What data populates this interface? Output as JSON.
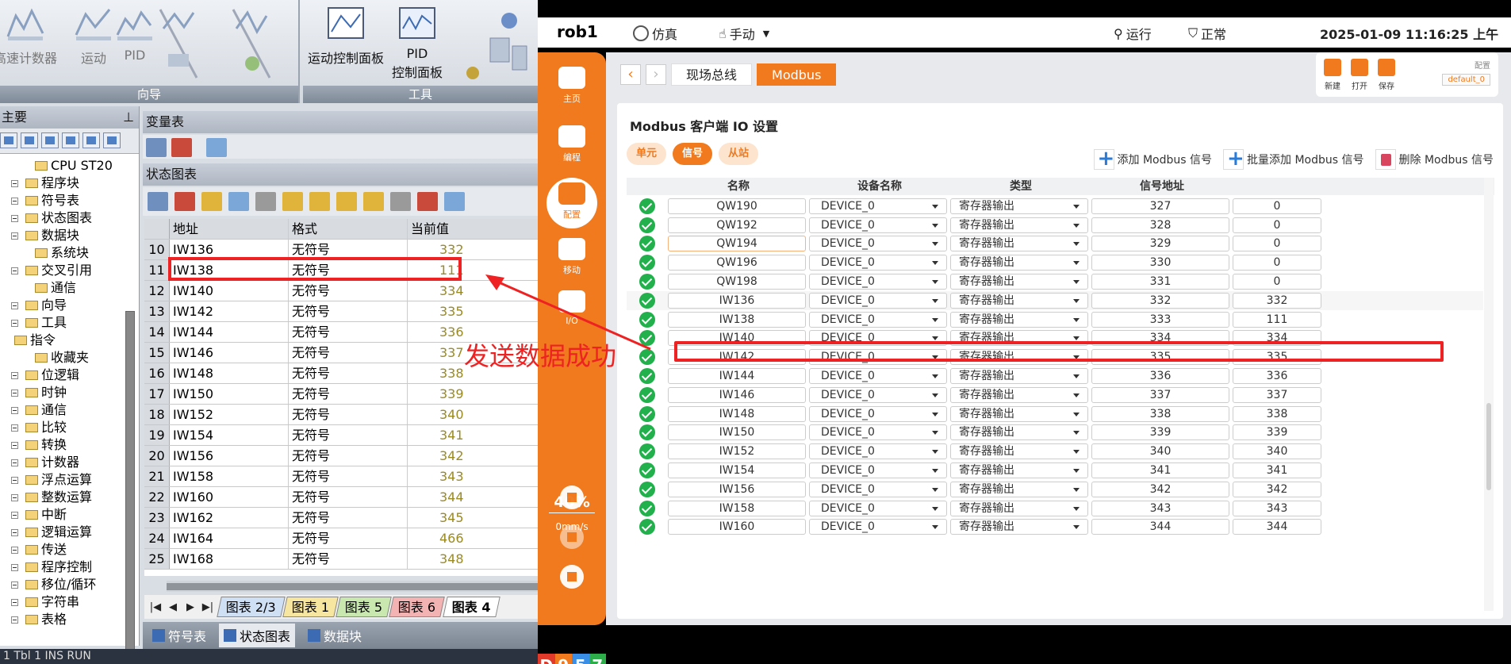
{
  "left": {
    "ribbon": {
      "groups": [
        {
          "title": "向导",
          "items": [
            "高速计数器",
            "运动",
            "PID"
          ]
        },
        {
          "title": "工具",
          "items": [
            "运动控制面板",
            "PID\n控制面板"
          ]
        }
      ]
    },
    "tree": {
      "header": "主要",
      "items": [
        {
          "label": "CPU ST20",
          "level": 2
        },
        {
          "label": "程序块",
          "level": 1
        },
        {
          "label": "符号表",
          "level": 1
        },
        {
          "label": "状态图表",
          "level": 1
        },
        {
          "label": "数据块",
          "level": 1
        },
        {
          "label": "系统块",
          "level": 2
        },
        {
          "label": "交叉引用",
          "level": 1
        },
        {
          "label": "通信",
          "level": 2
        },
        {
          "label": "向导",
          "level": 1
        },
        {
          "label": "工具",
          "level": 1
        },
        {
          "label": "指令",
          "level": 0
        },
        {
          "label": "收藏夹",
          "level": 2
        },
        {
          "label": "位逻辑",
          "level": 1
        },
        {
          "label": "时钟",
          "level": 1
        },
        {
          "label": "通信",
          "level": 1
        },
        {
          "label": "比较",
          "level": 1
        },
        {
          "label": "转换",
          "level": 1
        },
        {
          "label": "计数器",
          "level": 1
        },
        {
          "label": "浮点运算",
          "level": 1
        },
        {
          "label": "整数运算",
          "level": 1
        },
        {
          "label": "中断",
          "level": 1
        },
        {
          "label": "逻辑运算",
          "level": 1
        },
        {
          "label": "传送",
          "level": 1
        },
        {
          "label": "程序控制",
          "level": 1
        },
        {
          "label": "移位/循环",
          "level": 1
        },
        {
          "label": "字符串",
          "level": 1
        },
        {
          "label": "表格",
          "level": 1
        }
      ]
    },
    "var_table_title": "变量表",
    "status_chart_title": "状态图表",
    "grid": {
      "columns": [
        "",
        "地址",
        "格式",
        "当前值"
      ],
      "rows": [
        [
          "10",
          "IW136",
          "无符号",
          "332"
        ],
        [
          "11",
          "IW138",
          "无符号",
          "111"
        ],
        [
          "12",
          "IW140",
          "无符号",
          "334"
        ],
        [
          "13",
          "IW142",
          "无符号",
          "335"
        ],
        [
          "14",
          "IW144",
          "无符号",
          "336"
        ],
        [
          "15",
          "IW146",
          "无符号",
          "337"
        ],
        [
          "16",
          "IW148",
          "无符号",
          "338"
        ],
        [
          "17",
          "IW150",
          "无符号",
          "339"
        ],
        [
          "18",
          "IW152",
          "无符号",
          "340"
        ],
        [
          "19",
          "IW154",
          "无符号",
          "341"
        ],
        [
          "20",
          "IW156",
          "无符号",
          "342"
        ],
        [
          "21",
          "IW158",
          "无符号",
          "343"
        ],
        [
          "22",
          "IW160",
          "无符号",
          "344"
        ],
        [
          "23",
          "IW162",
          "无符号",
          "345"
        ],
        [
          "24",
          "IW164",
          "无符号",
          "466"
        ],
        [
          "25",
          "IW168",
          "无符号",
          "348"
        ]
      ]
    },
    "sheet_tabs": [
      {
        "label": "图表 2/3",
        "color": "#cfe0f5"
      },
      {
        "label": "图表 1",
        "color": "#f7e6a0"
      },
      {
        "label": "图表 5",
        "color": "#c9e8b0"
      },
      {
        "label": "图表 6",
        "color": "#f3b3b3"
      },
      {
        "label": "图表 4",
        "color": "#ffffff",
        "active": true
      }
    ],
    "bottom_tabs": [
      "符号表",
      "状态图表",
      "数据块"
    ],
    "status_text": "1  Tbl 1          INS      RUN"
  },
  "annotation": {
    "text": "发送数据成功",
    "color": "#e22222"
  },
  "right": {
    "robot_name": "rob1",
    "mode_sim": "仿真",
    "mode_manual": "手动",
    "status_run": "运行",
    "status_normal": "正常",
    "datetime": "2025-01-09 11:16:25 上午",
    "nav": [
      {
        "label": "主页"
      },
      {
        "label": "编程"
      },
      {
        "label": "配置",
        "active": true
      },
      {
        "label": "移动"
      },
      {
        "label": "I/O"
      }
    ],
    "speed_percent": "40%",
    "speed_unit": "0mm/s",
    "version_letters": [
      "D",
      "9",
      "5",
      "7"
    ],
    "version_colors": [
      "#e23a2a",
      "#f07a1d",
      "#3a8ee6",
      "#2eae4a"
    ],
    "breadcrumb": [
      "现场总线",
      "Modbus"
    ],
    "file_buttons": [
      "新建",
      "打开",
      "保存"
    ],
    "config_label": "配置",
    "config_value": "default_0",
    "card_title": "Modbus 客户端 IO 设置",
    "pills": [
      {
        "label": "单元"
      },
      {
        "label": "信号",
        "active": true
      },
      {
        "label": "从站"
      }
    ],
    "actions": [
      "添加 Modbus 信号",
      "批量添加 Modbus 信号",
      "删除 Modbus 信号"
    ],
    "columns": [
      "名称",
      "设备名称",
      "类型",
      "信号地址"
    ],
    "rows": [
      {
        "name": "QW190",
        "device": "DEVICE_0",
        "type": "寄存器输出",
        "addr": "327",
        "val": "0"
      },
      {
        "name": "QW192",
        "device": "DEVICE_0",
        "type": "寄存器输出",
        "addr": "328",
        "val": "0"
      },
      {
        "name": "QW194",
        "device": "DEVICE_0",
        "type": "寄存器输出",
        "addr": "329",
        "val": "0",
        "hl": true
      },
      {
        "name": "QW196",
        "device": "DEVICE_0",
        "type": "寄存器输出",
        "addr": "330",
        "val": "0"
      },
      {
        "name": "QW198",
        "device": "DEVICE_0",
        "type": "寄存器输出",
        "addr": "331",
        "val": "0"
      },
      {
        "name": "IW136",
        "device": "DEVICE_0",
        "type": "寄存器输出",
        "addr": "332",
        "val": "332",
        "sel": true
      },
      {
        "name": "IW138",
        "device": "DEVICE_0",
        "type": "寄存器输出",
        "addr": "333",
        "val": "111"
      },
      {
        "name": "IW140",
        "device": "DEVICE_0",
        "type": "寄存器输出",
        "addr": "334",
        "val": "334"
      },
      {
        "name": "IW142",
        "device": "DEVICE_0",
        "type": "寄存器输出",
        "addr": "335",
        "val": "335"
      },
      {
        "name": "IW144",
        "device": "DEVICE_0",
        "type": "寄存器输出",
        "addr": "336",
        "val": "336"
      },
      {
        "name": "IW146",
        "device": "DEVICE_0",
        "type": "寄存器输出",
        "addr": "337",
        "val": "337"
      },
      {
        "name": "IW148",
        "device": "DEVICE_0",
        "type": "寄存器输出",
        "addr": "338",
        "val": "338"
      },
      {
        "name": "IW150",
        "device": "DEVICE_0",
        "type": "寄存器输出",
        "addr": "339",
        "val": "339"
      },
      {
        "name": "IW152",
        "device": "DEVICE_0",
        "type": "寄存器输出",
        "addr": "340",
        "val": "340"
      },
      {
        "name": "IW154",
        "device": "DEVICE_0",
        "type": "寄存器输出",
        "addr": "341",
        "val": "341"
      },
      {
        "name": "IW156",
        "device": "DEVICE_0",
        "type": "寄存器输出",
        "addr": "342",
        "val": "342"
      },
      {
        "name": "IW158",
        "device": "DEVICE_0",
        "type": "寄存器输出",
        "addr": "343",
        "val": "343"
      },
      {
        "name": "IW160",
        "device": "DEVICE_0",
        "type": "寄存器输出",
        "addr": "344",
        "val": "344"
      }
    ]
  }
}
